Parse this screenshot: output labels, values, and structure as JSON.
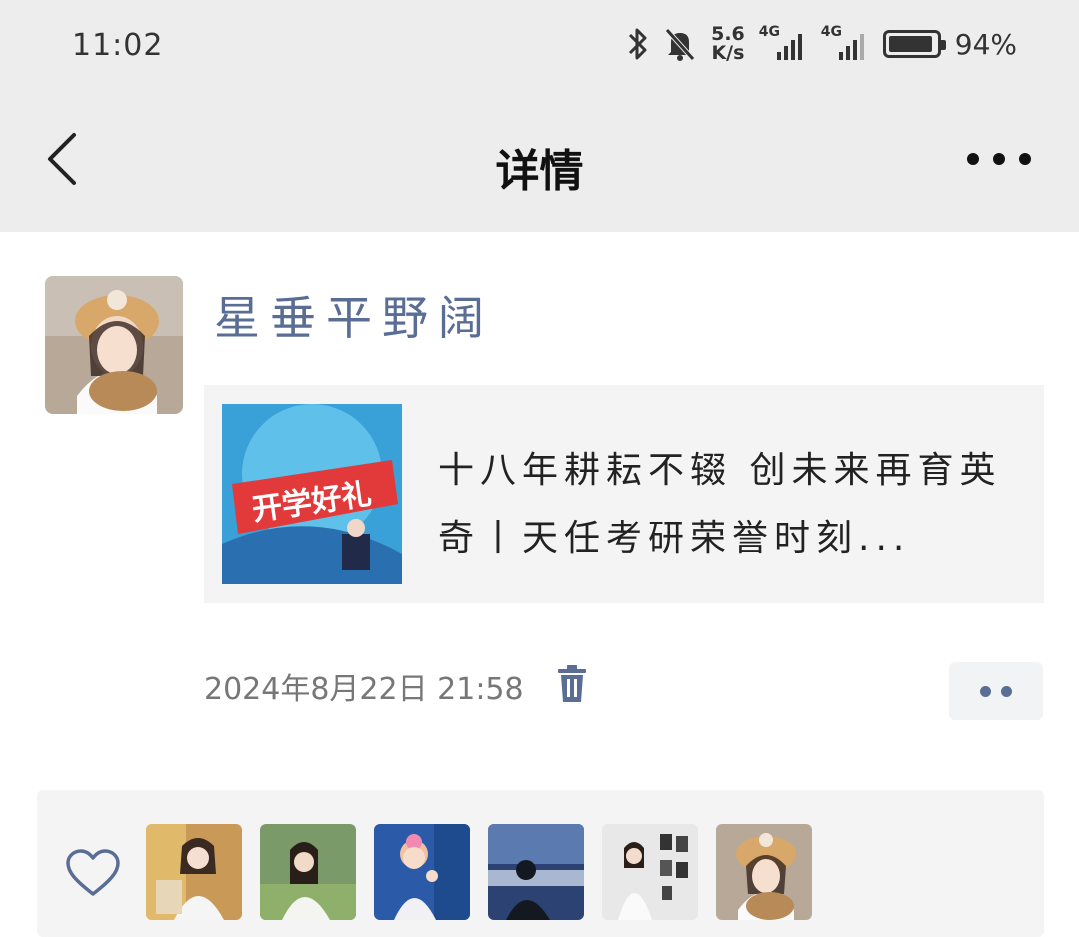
{
  "status_bar": {
    "time": "11:02",
    "net_speed_value": "5.6",
    "net_speed_unit": "K/s",
    "signal1_label": "4G",
    "signal2_label": "4G",
    "battery_percent": "94%",
    "battery_level": 0.94
  },
  "nav": {
    "title": "详情"
  },
  "post": {
    "author": "星垂平野阔",
    "share": {
      "thumb_label": "开学好礼",
      "text": "十八年耕耘不辍 创未来再育英奇丨天任考研荣誉时刻..."
    },
    "timestamp": "2024年8月22日  21:58"
  },
  "likes": {
    "avatars": [
      "like-avatar-1",
      "like-avatar-2",
      "like-avatar-3",
      "like-avatar-4",
      "like-avatar-5",
      "like-avatar-6"
    ]
  },
  "colors": {
    "bar_background": "#ededed",
    "link_blue": "#5a6d94",
    "card_background": "#f4f4f4"
  }
}
